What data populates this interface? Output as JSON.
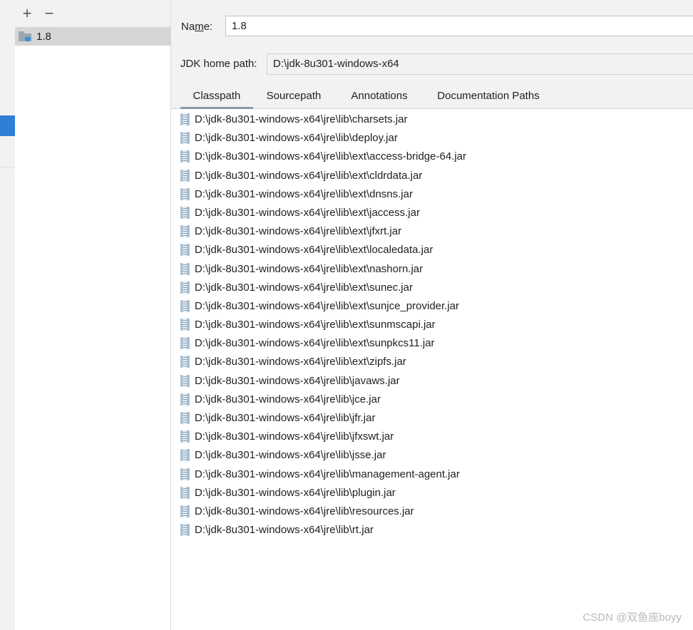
{
  "sdk_list": {
    "add_icon": "+",
    "remove_icon": "−",
    "items": [
      {
        "label": "1.8",
        "icon": "jdk-folder-icon",
        "selected": true
      }
    ]
  },
  "form": {
    "name_label": "Name:",
    "name_label_pre": "Na",
    "name_label_mnemonic": "m",
    "name_label_post": "e:",
    "name_value": "1.8",
    "jdk_home_label": "JDK home path:",
    "jdk_home_value": "D:\\jdk-8u301-windows-x64"
  },
  "tabs": [
    {
      "label": "Classpath",
      "active": true
    },
    {
      "label": "Sourcepath",
      "active": false
    },
    {
      "label": "Annotations",
      "active": false
    },
    {
      "label": "Documentation Paths",
      "active": false
    }
  ],
  "classpath": [
    "D:\\jdk-8u301-windows-x64\\jre\\lib\\charsets.jar",
    "D:\\jdk-8u301-windows-x64\\jre\\lib\\deploy.jar",
    "D:\\jdk-8u301-windows-x64\\jre\\lib\\ext\\access-bridge-64.jar",
    "D:\\jdk-8u301-windows-x64\\jre\\lib\\ext\\cldrdata.jar",
    "D:\\jdk-8u301-windows-x64\\jre\\lib\\ext\\dnsns.jar",
    "D:\\jdk-8u301-windows-x64\\jre\\lib\\ext\\jaccess.jar",
    "D:\\jdk-8u301-windows-x64\\jre\\lib\\ext\\jfxrt.jar",
    "D:\\jdk-8u301-windows-x64\\jre\\lib\\ext\\localedata.jar",
    "D:\\jdk-8u301-windows-x64\\jre\\lib\\ext\\nashorn.jar",
    "D:\\jdk-8u301-windows-x64\\jre\\lib\\ext\\sunec.jar",
    "D:\\jdk-8u301-windows-x64\\jre\\lib\\ext\\sunjce_provider.jar",
    "D:\\jdk-8u301-windows-x64\\jre\\lib\\ext\\sunmscapi.jar",
    "D:\\jdk-8u301-windows-x64\\jre\\lib\\ext\\sunpkcs11.jar",
    "D:\\jdk-8u301-windows-x64\\jre\\lib\\ext\\zipfs.jar",
    "D:\\jdk-8u301-windows-x64\\jre\\lib\\javaws.jar",
    "D:\\jdk-8u301-windows-x64\\jre\\lib\\jce.jar",
    "D:\\jdk-8u301-windows-x64\\jre\\lib\\jfr.jar",
    "D:\\jdk-8u301-windows-x64\\jre\\lib\\jfxswt.jar",
    "D:\\jdk-8u301-windows-x64\\jre\\lib\\jsse.jar",
    "D:\\jdk-8u301-windows-x64\\jre\\lib\\management-agent.jar",
    "D:\\jdk-8u301-windows-x64\\jre\\lib\\plugin.jar",
    "D:\\jdk-8u301-windows-x64\\jre\\lib\\resources.jar",
    "D:\\jdk-8u301-windows-x64\\jre\\lib\\rt.jar"
  ],
  "watermark": "CSDN @双鱼座boyy",
  "colors": {
    "selection_accent": "#2f7ed8",
    "selected_item_bg": "#d5d5d5",
    "panel_bg": "#f2f2f2",
    "tab_underline": "#8a99a8"
  }
}
